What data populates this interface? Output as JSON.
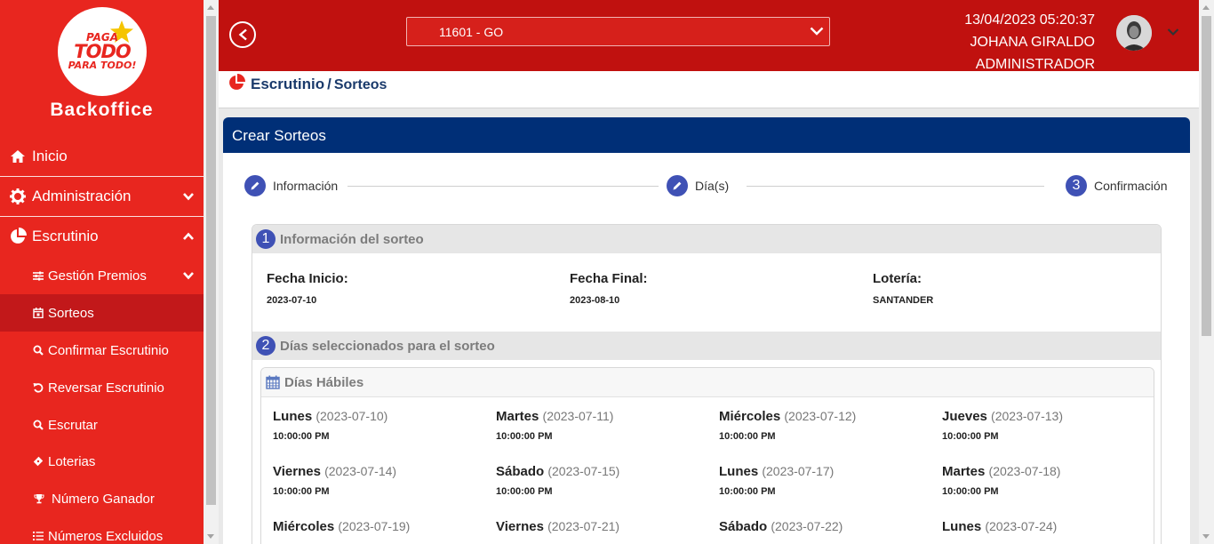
{
  "sidebar": {
    "logo": {
      "line1": "PAGA",
      "line2": "TODO",
      "line3": "PARA TODO!"
    },
    "brand": "Backoffice",
    "items": [
      {
        "label": "Inicio",
        "icon": "home-icon"
      },
      {
        "label": "Administración",
        "icon": "gear-icon"
      },
      {
        "label": "Escrutinio",
        "icon": "pie-chart-icon"
      }
    ],
    "subitems": [
      {
        "label": "Gestión Premios",
        "icon": "sliders-icon"
      },
      {
        "label": "Sorteos",
        "icon": "calendar-icon"
      },
      {
        "label": "Confirmar Escrutinio",
        "icon": "search-icon"
      },
      {
        "label": "Reversar Escrutinio",
        "icon": "undo-icon"
      },
      {
        "label": "Escrutar",
        "icon": "search-icon"
      },
      {
        "label": "Loterias",
        "icon": "ticket-icon"
      },
      {
        "label": "Número Ganador",
        "icon": "trophy-icon"
      },
      {
        "label": "Números Excluidos",
        "icon": "list-icon"
      }
    ]
  },
  "header": {
    "selector_value": "11601 - GO",
    "datetime": "13/04/2023 05:20:37",
    "user_name": "JOHANA GIRALDO",
    "role": "ADMINISTRADOR"
  },
  "breadcrumb": {
    "section": "Escrutinio",
    "separator": "/",
    "current": "Sorteos"
  },
  "card": {
    "title": "Crear Sorteos",
    "steps": [
      {
        "label": "Información",
        "marker": "edit-icon"
      },
      {
        "label": "Día(s)",
        "marker": "edit-icon"
      },
      {
        "label": "Confirmación",
        "number": "3"
      }
    ]
  },
  "info": {
    "section_number": "1",
    "section_title": "Información del sorteo",
    "fields": [
      {
        "label": "Fecha Inicio:",
        "value": "2023-07-10"
      },
      {
        "label": "Fecha Final:",
        "value": "2023-08-10"
      },
      {
        "label": "Lotería:",
        "value": "SANTANDER"
      }
    ]
  },
  "days": {
    "section_number": "2",
    "section_title": "Días seleccionados para el sorteo",
    "box_title": "Días Hábiles",
    "list": [
      {
        "day": "Lunes",
        "date": "(2023-07-10)",
        "time": "10:00:00 PM"
      },
      {
        "day": "Martes",
        "date": "(2023-07-11)",
        "time": "10:00:00 PM"
      },
      {
        "day": "Miércoles",
        "date": "(2023-07-12)",
        "time": "10:00:00 PM"
      },
      {
        "day": "Jueves",
        "date": "(2023-07-13)",
        "time": "10:00:00 PM"
      },
      {
        "day": "Viernes",
        "date": "(2023-07-14)",
        "time": "10:00:00 PM"
      },
      {
        "day": "Sábado",
        "date": "(2023-07-15)",
        "time": "10:00:00 PM"
      },
      {
        "day": "Lunes",
        "date": "(2023-07-17)",
        "time": "10:00:00 PM"
      },
      {
        "day": "Martes",
        "date": "(2023-07-18)",
        "time": "10:00:00 PM"
      },
      {
        "day": "Miércoles",
        "date": "(2023-07-19)",
        "time": ""
      },
      {
        "day": "Viernes",
        "date": "(2023-07-21)",
        "time": ""
      },
      {
        "day": "Sábado",
        "date": "(2023-07-22)",
        "time": ""
      },
      {
        "day": "Lunes",
        "date": "(2023-07-24)",
        "time": ""
      }
    ]
  },
  "colors": {
    "sidebar": "#e8261f",
    "header": "#c0110f",
    "card_header": "#002f77",
    "step": "#3f51b5"
  }
}
